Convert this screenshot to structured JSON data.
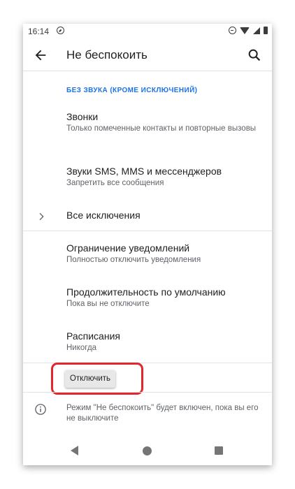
{
  "status_bar": {
    "time": "16:14",
    "icons": [
      "dnd-icon",
      "wifi-icon",
      "signal-icon",
      "battery-icon"
    ]
  },
  "app_bar": {
    "title": "Не беспокоить",
    "back_icon": "arrow-back-icon",
    "search_icon": "search-icon"
  },
  "section_header": "БЕЗ ЗВУКА (КРОМЕ ИСКЛЮЧЕНИЙ)",
  "items": [
    {
      "title": "Звонки",
      "subtitle": "Только помеченные контакты и повторные вызовы"
    },
    {
      "title": "Звуки SMS, MMS и мессенджеров",
      "subtitle": "Запретить все сообщения"
    },
    {
      "title": "Все исключения",
      "subtitle": ""
    },
    {
      "title": "Ограничение уведомлений",
      "subtitle": "Полностью отключить уведомления"
    },
    {
      "title": "Продолжительность по умолчанию",
      "subtitle": "Пока вы не отключите"
    },
    {
      "title": "Расписания",
      "subtitle": "Никогда"
    }
  ],
  "off_button": "Отключить",
  "info_text": "Режим \"Не беспокоить\" будет включен, пока вы его не выключите",
  "colors": {
    "accent": "#1a73e8",
    "highlight": "#e3262b"
  }
}
